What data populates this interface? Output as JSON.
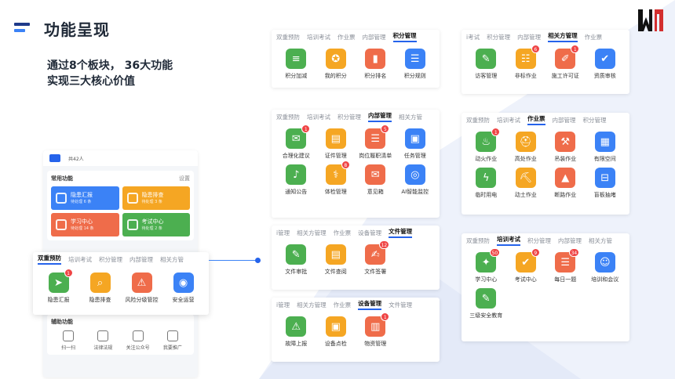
{
  "page": {
    "title": "功能呈现",
    "subtitle_line1": "通过8个板块， 36大功能",
    "subtitle_line2": "实现三大核心价值"
  },
  "colors": {
    "green": "#4caf50",
    "orange": "#f5a623",
    "red": "#ef6c4a",
    "blue": "#3b82f6",
    "badge": "#ef4444",
    "accent": "#2563eb"
  },
  "phone": {
    "count_text": "共42人",
    "common": {
      "title": "常用功能",
      "settings": "设置",
      "cards": [
        {
          "title": "隐患汇报",
          "sub": "待处理 6 条",
          "color": "#3b82f6"
        },
        {
          "title": "隐患排查",
          "sub": "待处理 3 条",
          "color": "#f5a623"
        },
        {
          "title": "学习中心",
          "sub": "待处理 14 条",
          "color": "#ef6c4a"
        },
        {
          "title": "考试中心",
          "sub": "待处理 2 条",
          "color": "#4caf50"
        }
      ]
    },
    "aux": {
      "title": "辅助功能",
      "items": [
        {
          "label": "扫一扫",
          "icon": "scan-icon"
        },
        {
          "label": "法律法规",
          "icon": "law-icon"
        },
        {
          "label": "关注公众号",
          "icon": "wechat-icon"
        },
        {
          "label": "我要推广",
          "icon": "share-icon"
        }
      ]
    }
  },
  "highlight": {
    "tabs": [
      "双重预防",
      "培训考试",
      "积分管理",
      "内部管理",
      "相关方管"
    ],
    "active": 0,
    "items": [
      {
        "label": "隐患汇报",
        "icon": "send-icon",
        "glyph": "➤",
        "color": "#4caf50",
        "badge": "1"
      },
      {
        "label": "隐患排查",
        "icon": "search-doc-icon",
        "glyph": "⌕",
        "color": "#f5a623",
        "badge": ""
      },
      {
        "label": "风险分级管控",
        "icon": "alarm-icon",
        "glyph": "⚠",
        "color": "#ef6c4a",
        "badge": ""
      },
      {
        "label": "安全运营",
        "icon": "shield-icon",
        "glyph": "◉",
        "color": "#3b82f6",
        "badge": ""
      }
    ]
  },
  "panels": [
    {
      "id": "points",
      "tabs": [
        "双重预防",
        "培训考试",
        "作业票",
        "内部管理",
        "积分管理"
      ],
      "active": 4,
      "items": [
        {
          "label": "积分加减",
          "icon": "database-icon",
          "glyph": "≡",
          "color": "#4caf50",
          "badge": ""
        },
        {
          "label": "我的积分",
          "icon": "medal-icon",
          "glyph": "✪",
          "color": "#f5a623",
          "badge": ""
        },
        {
          "label": "积分排名",
          "icon": "bar-chart-icon",
          "glyph": "▮",
          "color": "#ef6c4a",
          "badge": ""
        },
        {
          "label": "积分规则",
          "icon": "list-icon",
          "glyph": "☰",
          "color": "#3b82f6",
          "badge": ""
        }
      ]
    },
    {
      "id": "related",
      "tabs": [
        "i考试",
        "积分管理",
        "内部管理",
        "相关方管理",
        "作业票"
      ],
      "active": 3,
      "items": [
        {
          "label": "访客管理",
          "icon": "visitor-icon",
          "glyph": "✎",
          "color": "#4caf50",
          "badge": ""
        },
        {
          "label": "非标作业",
          "icon": "checklist-icon",
          "glyph": "☷",
          "color": "#f5a623",
          "badge": "6"
        },
        {
          "label": "施工许可证",
          "icon": "permit-icon",
          "glyph": "✐",
          "color": "#ef6c4a",
          "badge": "1"
        },
        {
          "label": "资质审核",
          "icon": "audit-icon",
          "glyph": "✔",
          "color": "#3b82f6",
          "badge": ""
        }
      ]
    },
    {
      "id": "internal",
      "tabs": [
        "双重预防",
        "培训考试",
        "积分管理",
        "内部管理",
        "相关方管"
      ],
      "active": 3,
      "items": [
        {
          "label": "合理化建议",
          "icon": "comment-icon",
          "glyph": "✉",
          "color": "#4caf50",
          "badge": "1"
        },
        {
          "label": "证件管理",
          "icon": "id-card-icon",
          "glyph": "▤",
          "color": "#f5a623",
          "badge": ""
        },
        {
          "label": "岗位履职清单",
          "icon": "duty-list-icon",
          "glyph": "☰",
          "color": "#ef6c4a",
          "badge": "5"
        },
        {
          "label": "任务管理",
          "icon": "folder-icon",
          "glyph": "▣",
          "color": "#3b82f6",
          "badge": ""
        },
        {
          "label": "通知公告",
          "icon": "bell-icon",
          "glyph": "♪",
          "color": "#4caf50",
          "badge": ""
        },
        {
          "label": "体检管理",
          "icon": "stethoscope-icon",
          "glyph": "⚕",
          "color": "#f5a623",
          "badge": "8"
        },
        {
          "label": "意见箱",
          "icon": "inbox-icon",
          "glyph": "✉",
          "color": "#ef6c4a",
          "badge": ""
        },
        {
          "label": "AI智能监控",
          "icon": "camera-icon",
          "glyph": "◎",
          "color": "#3b82f6",
          "badge": ""
        }
      ]
    },
    {
      "id": "worktickets",
      "tabs": [
        "双重预防",
        "培训考试",
        "作业票",
        "内部管理",
        "积分管理"
      ],
      "active": 2,
      "items": [
        {
          "label": "动火作业",
          "icon": "fire-icon",
          "glyph": "♨",
          "color": "#4caf50",
          "badge": "1"
        },
        {
          "label": "高处作业",
          "icon": "helmet-icon",
          "glyph": "⛑",
          "color": "#f5a623",
          "badge": ""
        },
        {
          "label": "吊装作业",
          "icon": "crane-icon",
          "glyph": "⚒",
          "color": "#ef6c4a",
          "badge": ""
        },
        {
          "label": "有限空间",
          "icon": "space-icon",
          "glyph": "▦",
          "color": "#3b82f6",
          "badge": ""
        },
        {
          "label": "临时用电",
          "icon": "lightning-icon",
          "glyph": "ϟ",
          "color": "#4caf50",
          "badge": ""
        },
        {
          "label": "动土作业",
          "icon": "shovel-icon",
          "glyph": "⛏",
          "color": "#f5a623",
          "badge": ""
        },
        {
          "label": "断路作业",
          "icon": "cone-icon",
          "glyph": "▲",
          "color": "#ef6c4a",
          "badge": ""
        },
        {
          "label": "盲板抽堵",
          "icon": "valve-icon",
          "glyph": "⊟",
          "color": "#3b82f6",
          "badge": ""
        }
      ]
    },
    {
      "id": "files",
      "tabs": [
        "i管理",
        "相关方管理",
        "作业票",
        "设备管理",
        "文件管理"
      ],
      "active": 4,
      "items": [
        {
          "label": "文件审批",
          "icon": "file-approve-icon",
          "glyph": "✎",
          "color": "#4caf50",
          "badge": ""
        },
        {
          "label": "文件查阅",
          "icon": "file-view-icon",
          "glyph": "▤",
          "color": "#f5a623",
          "badge": ""
        },
        {
          "label": "文件签署",
          "icon": "file-sign-icon",
          "glyph": "✍",
          "color": "#ef6c4a",
          "badge": "12"
        }
      ]
    },
    {
      "id": "training",
      "tabs": [
        "双重预防",
        "培训考试",
        "积分管理",
        "内部管理",
        "相关方管"
      ],
      "active": 1,
      "items": [
        {
          "label": "学习中心",
          "icon": "graduation-icon",
          "glyph": "✦",
          "color": "#4caf50",
          "badge": "50"
        },
        {
          "label": "考试中心",
          "icon": "exam-icon",
          "glyph": "✔",
          "color": "#f5a623",
          "badge": "9"
        },
        {
          "label": "每日一题",
          "icon": "daily-question-icon",
          "glyph": "☰",
          "color": "#ef6c4a",
          "badge": "34"
        },
        {
          "label": "培训和会议",
          "icon": "meeting-icon",
          "glyph": "☺",
          "color": "#3b82f6",
          "badge": ""
        },
        {
          "label": "三级安全教育",
          "icon": "education-icon",
          "glyph": "✎",
          "color": "#4caf50",
          "badge": ""
        }
      ]
    },
    {
      "id": "equipment",
      "tabs": [
        "i管理",
        "相关方管理",
        "作业票",
        "设备管理",
        "文件管理"
      ],
      "active": 3,
      "items": [
        {
          "label": "故障上报",
          "icon": "fault-report-icon",
          "glyph": "⚠",
          "color": "#4caf50",
          "badge": ""
        },
        {
          "label": "设备点检",
          "icon": "device-check-icon",
          "glyph": "▣",
          "color": "#f5a623",
          "badge": ""
        },
        {
          "label": "物资管理",
          "icon": "inventory-icon",
          "glyph": "▥",
          "color": "#ef6c4a",
          "badge": "1"
        }
      ]
    }
  ]
}
